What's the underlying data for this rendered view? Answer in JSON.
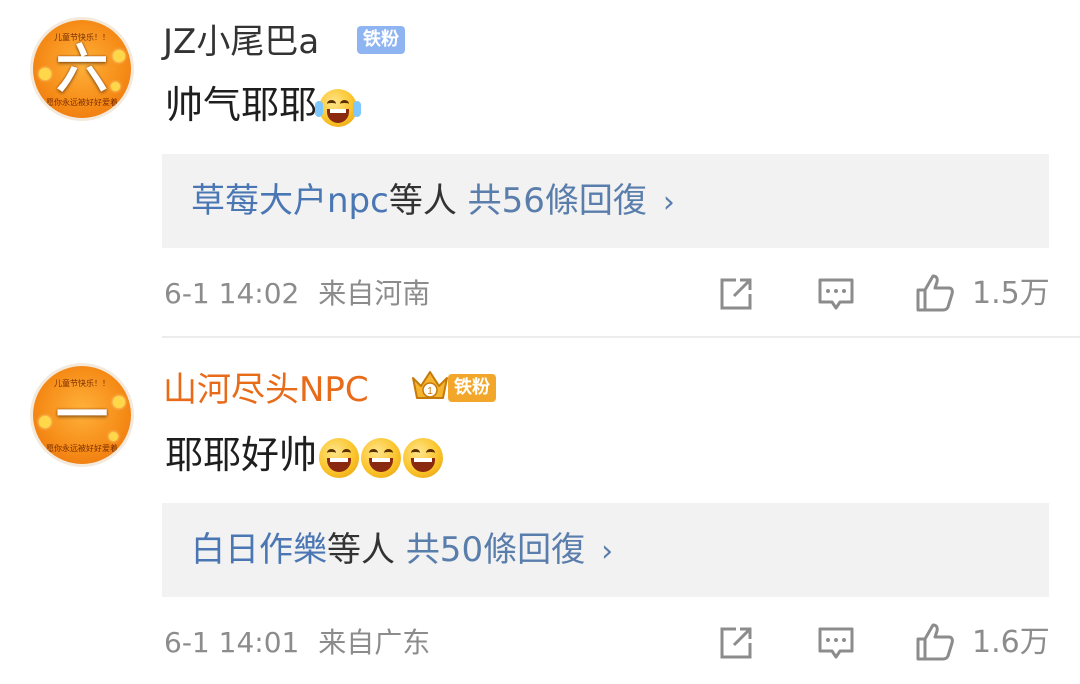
{
  "comments": [
    {
      "avatar": {
        "glyph": "六",
        "ring_top": "儿童节快乐！！",
        "ring_bottom": "愿你永远被好好爱着"
      },
      "username": "JZ小尾巴a",
      "badge": "铁粉",
      "text": "帅气耶耶",
      "emojis": [
        "cheer-emoji"
      ],
      "replies": {
        "who": "草莓大户npc",
        "mid": "等人",
        "count_text": "共56條回復"
      },
      "timestamp": "6-1 14:02",
      "location": "来自河南",
      "likes": "1.5万"
    },
    {
      "avatar": {
        "glyph": "一",
        "ring_top": "儿童节快乐！！",
        "ring_bottom": "愿你永远被好好爱着"
      },
      "username": "山河尽头NPC",
      "badge": "铁粉",
      "crown_level": "1",
      "text": "耶耶好帅",
      "emojis": [
        "laugh-emoji",
        "laugh-emoji",
        "laugh-emoji"
      ],
      "replies": {
        "who": "白日作樂",
        "mid": "等人",
        "count_text": "共50條回復"
      },
      "timestamp": "6-1 14:01",
      "location": "来自广东",
      "likes": "1.6万"
    }
  ],
  "icons": {
    "share": "share-icon",
    "comment": "comment-icon",
    "like": "thumb-up-icon"
  },
  "colors": {
    "link_blue": "#5a7eac",
    "username_orange": "#e86b1a",
    "badge_blue": "#8fb4f2",
    "badge_gold": "#f2a72a",
    "meta_gray": "#8c8c8c"
  }
}
